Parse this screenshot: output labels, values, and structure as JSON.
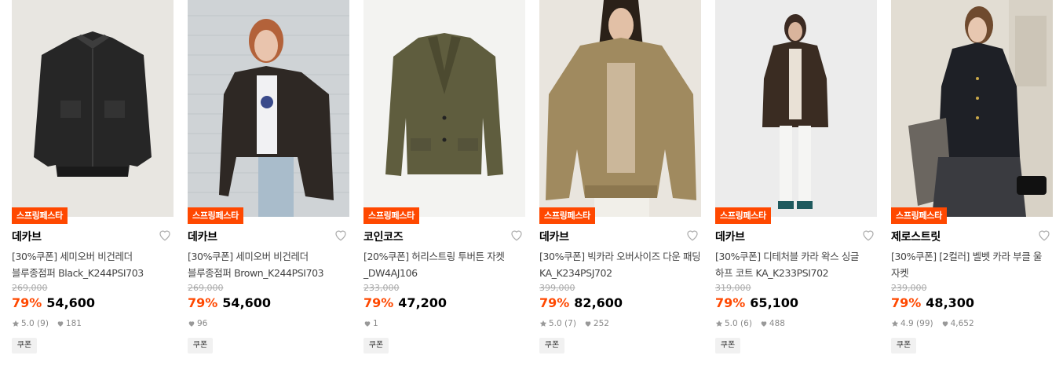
{
  "products": [
    {
      "badge": "스프링페스타",
      "brand": "데카브",
      "name": "[30%쿠폰] 세미오버 비건레더 블루종점퍼 Black_K244PSI703",
      "original_price": "269,000",
      "discount": "79%",
      "price": "54,600",
      "rating": "5.0",
      "reviews": "(9)",
      "likes": "181",
      "coupon": "쿠폰",
      "colors": {
        "bg": "#e8e6e1",
        "item": "#262626"
      }
    },
    {
      "badge": "스프링페스타",
      "brand": "데카브",
      "name": "[30%쿠폰] 세미오버 비건레더 블루종점퍼 Brown_K244PSI703",
      "original_price": "269,000",
      "discount": "79%",
      "price": "54,600",
      "rating": "",
      "reviews": "",
      "likes": "96",
      "coupon": "쿠폰",
      "colors": {
        "bg": "#cfd3d6",
        "item": "#2e2824"
      }
    },
    {
      "badge": "스프링페스타",
      "brand": "코인코즈",
      "name": "[20%쿠폰] 허리스트링 투버튼 자켓 _DW4AJ106",
      "original_price": "233,000",
      "discount": "79%",
      "price": "47,200",
      "rating": "",
      "reviews": "",
      "likes": "1",
      "coupon": "쿠폰",
      "colors": {
        "bg": "#f3f3f1",
        "item": "#5f5d3e"
      }
    },
    {
      "badge": "스프링페스타",
      "brand": "데카브",
      "name": "[30%쿠폰] 빅카라 오버사이즈 다운 패딩 KA_K234PSJ702",
      "original_price": "399,000",
      "discount": "79%",
      "price": "82,600",
      "rating": "5.0",
      "reviews": "(7)",
      "likes": "252",
      "coupon": "쿠폰",
      "colors": {
        "bg": "#e9e5de",
        "item": "#a08a5f"
      }
    },
    {
      "badge": "스프링페스타",
      "brand": "데카브",
      "name": "[30%쿠폰] 디테처블 카라 왁스 싱글 하프 코트 KA_K233PSI702",
      "original_price": "319,000",
      "discount": "79%",
      "price": "65,100",
      "rating": "5.0",
      "reviews": "(6)",
      "likes": "488",
      "coupon": "쿠폰",
      "colors": {
        "bg": "#ececec",
        "item": "#3a2c22"
      }
    },
    {
      "badge": "스프링페스타",
      "brand": "제로스트릿",
      "name": "[30%쿠폰] [2컬러] 벨벳 카라 부클 울 자켓",
      "original_price": "239,000",
      "discount": "79%",
      "price": "48,300",
      "rating": "4.9",
      "reviews": "(99)",
      "likes": "4,652",
      "coupon": "쿠폰",
      "colors": {
        "bg": "#e2ddd3",
        "item": "#1e2026"
      }
    }
  ]
}
